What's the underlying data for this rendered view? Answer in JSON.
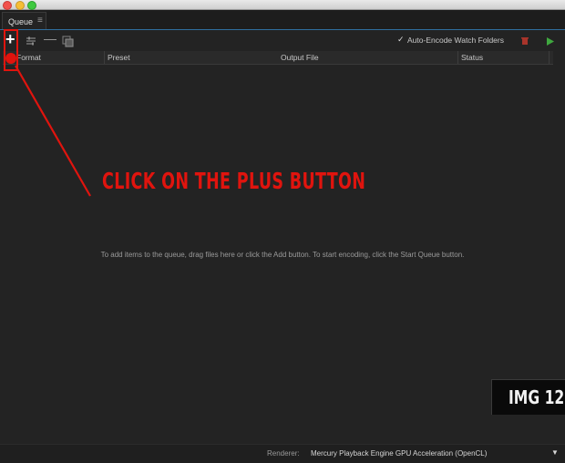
{
  "window": {
    "traffic_lights": [
      "close",
      "minimize",
      "maximize"
    ]
  },
  "tabs": [
    {
      "label": "Queue",
      "menu_icon": "≡"
    }
  ],
  "toolbar": {
    "add_icon": "plus-icon",
    "settings_icon": "queue-settings-icon",
    "remove_icon": "minus-icon",
    "duplicate_icon": "duplicate-icon",
    "auto_encode": {
      "checked": true,
      "check_glyph": "✓",
      "label": "Auto-Encode Watch Folders"
    },
    "stop_icon": "stop-icon",
    "start_icon": "start-queue-icon"
  },
  "queue_table": {
    "columns": [
      "Format",
      "Preset",
      "Output File",
      "Status"
    ],
    "empty_message": "To add items to the queue, drag files here or click the Add button.  To start encoding, click the Start Queue button."
  },
  "renderer": {
    "label": "Renderer:",
    "value": "Mercury Playback Engine GPU Acceleration (OpenCL)",
    "dropdown_glyph": "▼"
  },
  "annotation": {
    "callout": "CLICK ON THE PLUS BUTTON",
    "badge": "IMG 12",
    "color": "#e0140e"
  },
  "colors": {
    "accent_blue": "#2f6fa0",
    "start_green": "#3fa83f",
    "stop_red": "#c0392b"
  }
}
